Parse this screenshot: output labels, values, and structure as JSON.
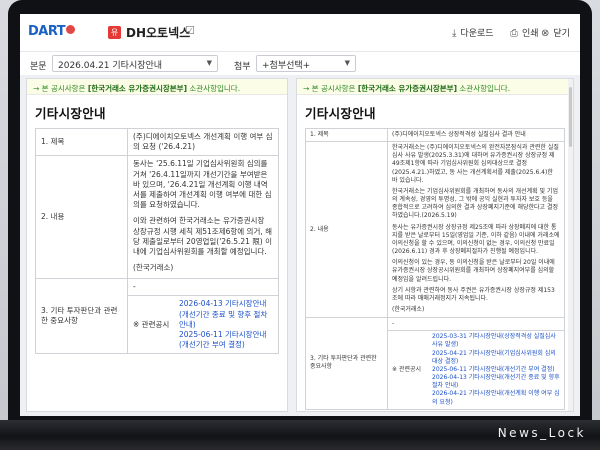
{
  "watermark": "News_Lock",
  "topbar": {
    "logo": "DART",
    "company_badge": "유",
    "company_name": "DH오토넥스",
    "edit_icon": "☑",
    "download_label": "다운로드",
    "print_label": "인쇄",
    "close_label": "닫기"
  },
  "filter": {
    "main_label": "본문",
    "main_value": "2026.04.21  기타시장안내",
    "attach_label": "첨부",
    "attach_value": "+첨부선택+"
  },
  "left": {
    "notice_prefix": "→ 본 공시사항은 ",
    "notice_org": "[한국거래소 유가증권시장본부]",
    "notice_suffix": " 소관사항입니다.",
    "title": "기타시장안내",
    "row1_label": "1. 제목",
    "row1_value": "(주)디에이치오토넥스 개선계획 이행 여부 심의 요청 ('26.4.21)",
    "row2_label": "2. 내용",
    "row2_paragraphs": [
      "동사는 '25.6.11일 기업심사위원회 심의를 거쳐 '26.4.11일까지 개선기간을 부여받은 바 있으며, '26.4.21일 개선계획 이행 내역서를 제출하여 개선계획 이행 여부에 대한 심의를 요청하였습니다.",
      "이와 관련하여 한국거래소는 유가증권시장 상장규정 시행 세칙 제51조제6항에 의거, 해당 제출일로부터 20영업일('26.5.21 限) 이내에 기업심사위원회를 개최할 예정입니다.",
      "(한국거래소)"
    ],
    "row3_label": "3. 기타 투자판단과 관련한 중요사항",
    "row3_value": "-",
    "related_label": "※ 관련공시",
    "related_links": [
      "2026-04-13 기타시장안내(개선기간 종료 및 향후 절차 안내)",
      "2025-06-11 기타시장안내(개선기간 부여 결정)"
    ]
  },
  "right": {
    "notice_prefix": "→ 본 공시사항은 ",
    "notice_org": "[한국거래소 유가증권시장본부]",
    "notice_suffix": " 소관사항입니다.",
    "title": "기타시장안내",
    "row1_label": "1. 제목",
    "row1_value": "(주)디에이치오토넥스 상장적격성 실질심사 결과 안내",
    "row2_label": "2. 내용",
    "row2_paragraphs": [
      "한국거래소는 (주)디에이치오토넥스의 완전자본잠식과 관련한 실질심사 사유 발생(2025.3.31)에 대하여 유가증권시장 상장규정 제49조제1항에 따라 기업심사위원회 심의대상으로 결정(2025.4.21.)하였고, 동 사는 개선계획서를 제출(2025.6.4)한 바 있습니다.",
      "한국거래소는 기업심사위원회를 개최하여 동사의 개선계획 및 기업의 계속성, 경영의 투명성, 그 밖에 공익 실현과 투자자 보호 등을 종합적으로 고려하여 심의한 결과 상장폐지기준에 해당한다고 결정하였습니다.(2026.5.19)",
      "동사는 유가증권시장 상장규정 제25조에 따라 상장폐지에 대한 통지를 받은 날로부터 15일(영업일 기준, 이하 같음) 이내에 거래소에 이의신청을 할 수 있으며, 이의신청이 없는 경우, 이의신청 만료일(2026.6.11) 경과 후 상장폐지절차가 진행될 예정입니다.",
      "이의신청이 있는 경우, 동 이의신청을 받은 날로부터 20일 이내에 유가증권시장 상장공시위원회를 개최하여 상장폐지여부를 심의할 예정임을 알려드립니다.",
      "상기 사항과 관련하여 동사 주권은 유가증권시장 상장규정 제153조에 따라 매매거래정지가 지속됩니다.",
      "(한국거래소)"
    ],
    "row3_label": "3. 기타 투자판단과 관련한 중요사항",
    "row3_value": "-",
    "related_label": "※ 관련공시",
    "related_links": [
      "2025-03-31 기타시장안내(상장적격성 실질심사 사유 발생)",
      "2025-04-21 기타시장안내(기업심사위원회 심의대상 결정)",
      "2025-06-11 기타시장안내(개선기간 부여 결정)",
      "2026-04-13 기타시장안내(개선기간 종료 및 향후 절차 안내)",
      "2026-04-21 기타시장안내(개선계획 이행 여부 심의 요청)"
    ]
  }
}
